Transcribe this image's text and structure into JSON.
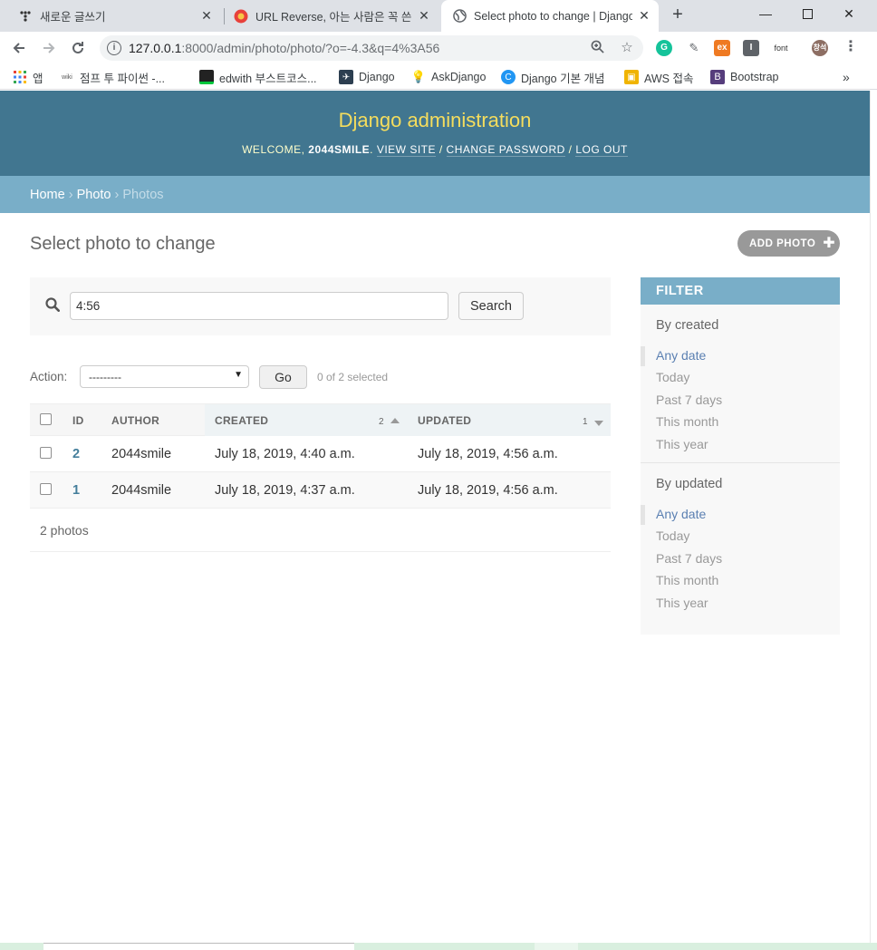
{
  "browser": {
    "tabs": [
      {
        "title": "새로운 글쓰기"
      },
      {
        "title": "URL Reverse, 아는 사람은 꼭 쓴"
      },
      {
        "title": "Select photo to change | Django"
      }
    ],
    "url_host": "127.0.0.1",
    "url_path": ":8000/admin/photo/photo/?o=-4.3&q=4%3A56",
    "extension_font_label": "font",
    "profile_label": "창석",
    "bookmarks": [
      {
        "label": "앱"
      },
      {
        "label": "점프 투 파이썬 -..."
      },
      {
        "label": "edwith 부스트코스..."
      },
      {
        "label": "Django"
      },
      {
        "label": "AskDjango"
      },
      {
        "label": "Django 기본 개념"
      },
      {
        "label": "AWS 접속"
      },
      {
        "label": "Bootstrap"
      }
    ],
    "bookmark_wiki_label": "wiki"
  },
  "admin": {
    "branding": "Django administration",
    "welcome": "Welcome,",
    "username": "2044smile",
    "view_site": "View site",
    "change_password": "Change password",
    "log_out": "Log out"
  },
  "breadcrumbs": {
    "home": "Home",
    "photo": "Photo",
    "current": "Photos"
  },
  "page": {
    "title": "Select photo to change",
    "add_label": "Add photo"
  },
  "search": {
    "value": "4:56",
    "button": "Search"
  },
  "actions": {
    "label": "Action:",
    "selected": "---------",
    "go": "Go",
    "counter": "0 of 2 selected"
  },
  "table": {
    "columns": {
      "id": "ID",
      "author": "Author",
      "created": "Created",
      "created_priority": "2",
      "updated": "Updated",
      "updated_priority": "1"
    },
    "rows": [
      {
        "id": "2",
        "author": "2044smile",
        "created": "July 18, 2019, 4:40 a.m.",
        "updated": "July 18, 2019, 4:56 a.m."
      },
      {
        "id": "1",
        "author": "2044smile",
        "created": "July 18, 2019, 4:37 a.m.",
        "updated": "July 18, 2019, 4:56 a.m."
      }
    ],
    "paginator": "2 photos"
  },
  "filter": {
    "heading": "Filter",
    "groups": [
      {
        "title": "By created",
        "items": [
          "Any date",
          "Today",
          "Past 7 days",
          "This month",
          "This year"
        ]
      },
      {
        "title": "By updated",
        "items": [
          "Any date",
          "Today",
          "Past 7 days",
          "This month",
          "This year"
        ]
      }
    ]
  },
  "colors": {
    "header_bg": "#417690",
    "branding": "#f5dd5d",
    "breadcrumbs_bg": "#79aec8",
    "link": "#447e9b",
    "filter_selected": "#5b80b2"
  }
}
